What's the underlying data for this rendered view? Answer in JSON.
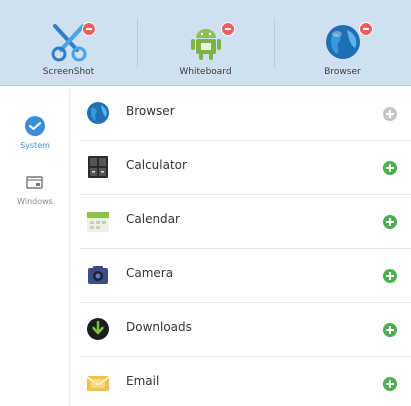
{
  "pinned": [
    {
      "label": "ScreenShot",
      "icon": "scissors-icon"
    },
    {
      "label": "Whiteboard",
      "icon": "android-icon"
    },
    {
      "label": "Browser",
      "icon": "globe-icon"
    }
  ],
  "sidebar": {
    "categories": [
      {
        "label": "System",
        "icon": "check-circle-icon",
        "active": true
      },
      {
        "label": "Windows",
        "icon": "window-icon",
        "active": false
      }
    ]
  },
  "apps": [
    {
      "name": "Browser",
      "icon": "globe-icon",
      "state": "added"
    },
    {
      "name": "Calculator",
      "icon": "calculator-icon",
      "state": "add"
    },
    {
      "name": "Calendar",
      "icon": "calendar-icon",
      "state": "add"
    },
    {
      "name": "Camera",
      "icon": "camera-icon",
      "state": "add"
    },
    {
      "name": "Downloads",
      "icon": "download-icon",
      "state": "add"
    },
    {
      "name": "Email",
      "icon": "email-icon",
      "state": "add"
    }
  ],
  "colors": {
    "topbar": "#cfe0f0",
    "accent": "#3b8fd9",
    "add": "#4caf50",
    "added": "#c4c4c4",
    "remove_badge": "#ec5f5f"
  }
}
